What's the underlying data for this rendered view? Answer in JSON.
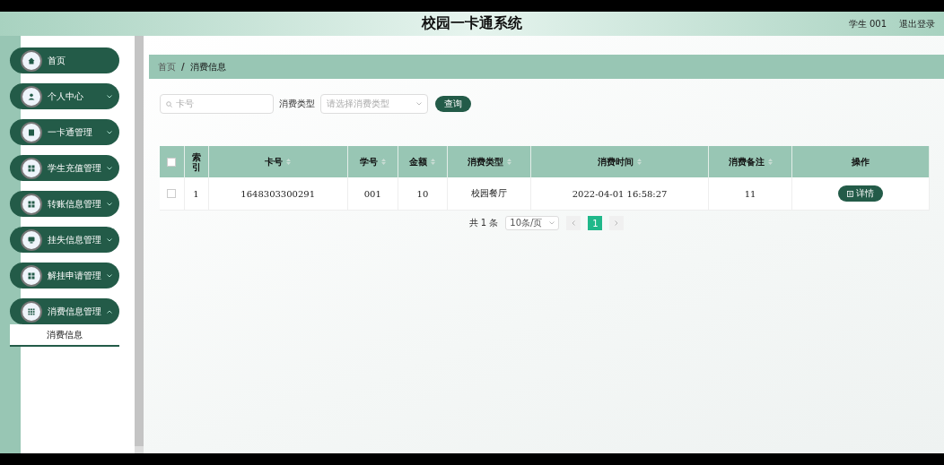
{
  "header": {
    "title": "校园一卡通系统",
    "user": "学生 001",
    "logout": "退出登录"
  },
  "sidebar": {
    "items": [
      {
        "label": "首页",
        "kind": "home"
      },
      {
        "label": "个人中心",
        "kind": "user",
        "expanded": false
      },
      {
        "label": "一卡通管理",
        "kind": "book",
        "expanded": false
      },
      {
        "label": "学生充值管理",
        "kind": "grid",
        "expanded": false
      },
      {
        "label": "转账信息管理",
        "kind": "grid",
        "expanded": false
      },
      {
        "label": "挂失信息管理",
        "kind": "monitor",
        "expanded": false
      },
      {
        "label": "解挂申请管理",
        "kind": "grid",
        "expanded": false
      },
      {
        "label": "消费信息管理",
        "kind": "dots",
        "expanded": true,
        "children": [
          {
            "label": "消费信息",
            "selected": true
          }
        ]
      }
    ]
  },
  "breadcrumb": {
    "items": [
      "首页",
      "消费信息"
    ],
    "separator": "/"
  },
  "search": {
    "card_placeholder": "卡号",
    "type_label": "消费类型",
    "type_placeholder": "请选择消费类型",
    "button": "查询"
  },
  "table": {
    "all_checked": false,
    "columns": [
      {
        "label": "索引",
        "sortable": false
      },
      {
        "label": "卡号",
        "sortable": true
      },
      {
        "label": "学号",
        "sortable": true
      },
      {
        "label": "金额",
        "sortable": true
      },
      {
        "label": "消费类型",
        "sortable": true
      },
      {
        "label": "消费时间",
        "sortable": true
      },
      {
        "label": "消费备注",
        "sortable": true
      },
      {
        "label": "操作",
        "sortable": false
      }
    ],
    "rows": [
      {
        "checked": false,
        "cells": [
          "1",
          "1648303300291",
          "001",
          "10",
          "校园餐厅",
          "2022-04-01 16:58:27",
          "11"
        ],
        "action": "详情"
      }
    ]
  },
  "pagination": {
    "total": "共 1 条",
    "page_size": "10条/页",
    "pages": [
      {
        "label": "1",
        "selected": true
      }
    ]
  }
}
